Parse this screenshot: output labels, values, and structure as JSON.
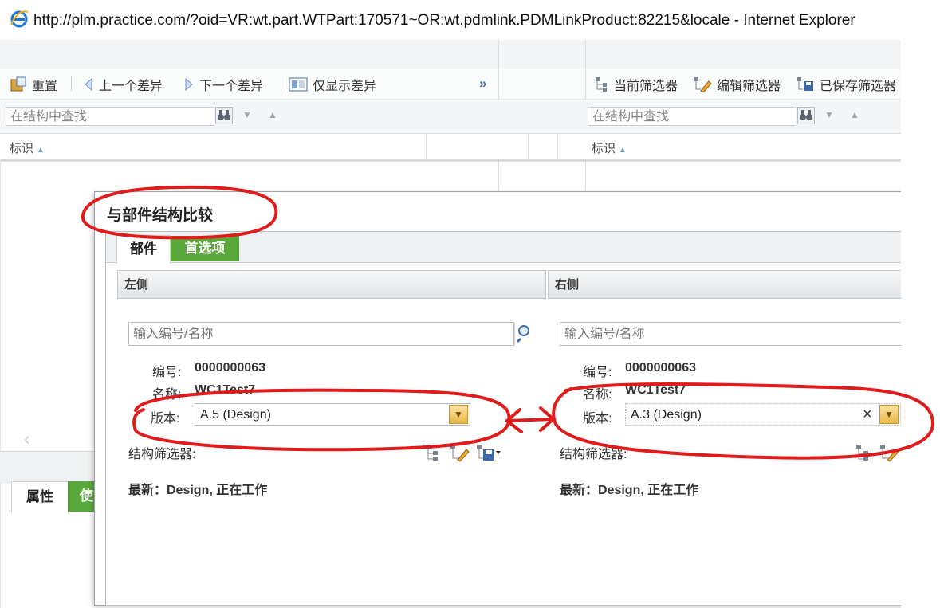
{
  "window": {
    "title": "http://plm.practice.com/?oid=VR:wt.part.WTPart:170571~OR:wt.pdmlink.PDMLinkProduct:82215&locale - Internet Explorer",
    "browser_icon": "internet-explorer-icon"
  },
  "left_toolbar": {
    "reset_label": "重置",
    "prev_diff_label": "上一个差异",
    "next_diff_label": "下一个差异",
    "show_diff_only_label": "仅显示差异",
    "more_label": "»"
  },
  "right_toolbar": {
    "current_filter_label": "当前筛选器",
    "edit_filter_label": "编辑筛选器",
    "saved_filter_label": "已保存筛选器"
  },
  "structure_search": {
    "left_placeholder": "在结构中查找",
    "right_placeholder": "在结构中查找"
  },
  "tree_columns": {
    "left_identifier": "标识",
    "right_identifier": "标识"
  },
  "bottom_left_tabs": {
    "attributes_label": "属性",
    "usage_label": "使"
  },
  "dialog": {
    "title": "与部件结构比较",
    "tabs": {
      "part_label": "部件",
      "preferences_label": "首选项"
    },
    "left": {
      "header": "左侧",
      "search_placeholder": "输入编号/名称",
      "number_label": "编号:",
      "number_value": "0000000063",
      "name_label": "名称:",
      "name_value": "WC1Test7",
      "version_label": "版本:",
      "version_value": "A.5 (Design)",
      "structure_filter_label": "结构筛选器:",
      "latest_text": "最新：Design, 正在工作"
    },
    "right": {
      "header": "右侧",
      "search_placeholder": "输入编号/名称",
      "number_label": "编号:",
      "number_value": "0000000063",
      "name_label": "名称:",
      "name_value": "WC1Test7",
      "version_label": "版本:",
      "version_value": "A.3 (Design)",
      "clear_symbol": "×",
      "structure_filter_label": "结构筛选器:",
      "latest_text": "最新：Design, 正在工作"
    }
  },
  "colors": {
    "green_tab": "#5aa83a",
    "annotation_red": "#e01b1b",
    "dropdown_gold": "#e9b94a"
  }
}
